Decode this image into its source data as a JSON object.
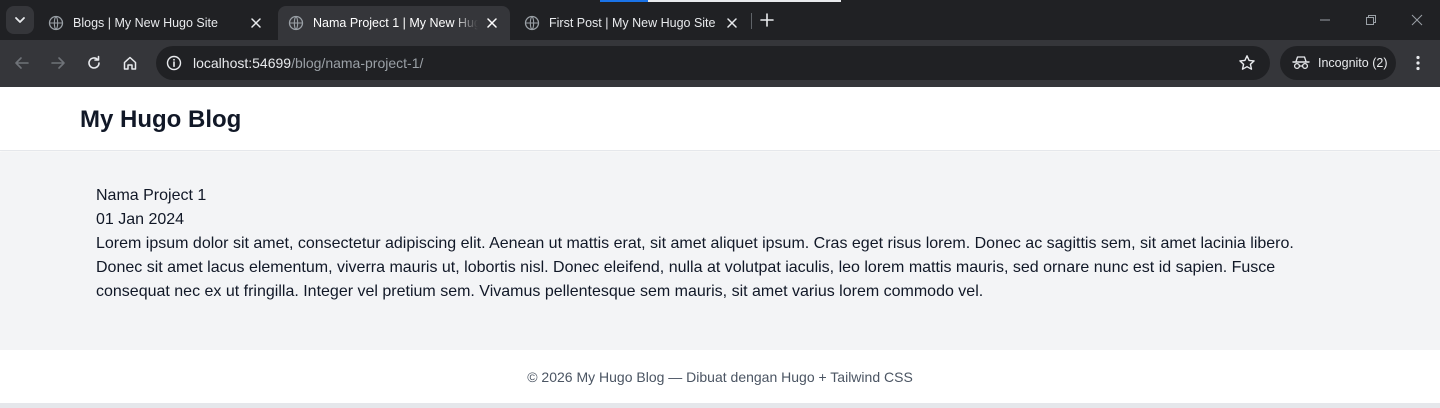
{
  "browser": {
    "tabs": [
      {
        "title": "Blogs | My New Hugo Site",
        "active": false
      },
      {
        "title": "Nama Project 1 | My New Hugo Site",
        "active": true
      },
      {
        "title": "First Post | My New Hugo Site",
        "active": false
      }
    ],
    "url_host": "localhost:54699",
    "url_path": "/blog/nama-project-1/",
    "incognito_label": "Incognito (2)"
  },
  "site": {
    "logo": "My Hugo Blog",
    "footer": "© 2026 My Hugo Blog — Dibuat dengan Hugo + Tailwind CSS"
  },
  "post": {
    "title": "Nama Project 1",
    "date": "01 Jan 2024",
    "body": "Lorem ipsum dolor sit amet, consectetur adipiscing elit. Aenean ut mattis erat, sit amet aliquet ipsum. Cras eget risus lorem. Donec ac sagittis sem, sit amet lacinia libero. Donec sit amet lacus elementum, viverra mauris ut, lobortis nisl. Donec eleifend, nulla at volutpat iaculis, leo lorem mattis mauris, sed ornare nunc est id sapien. Fusce consequat nec ex ut fringilla. Integer vel pretium sem. Vivamus pellentesque sem mauris, sit amet varius lorem commodo vel."
  },
  "icons": {
    "tab_search": "chevron-down-icon",
    "favicon": "globe-icon",
    "tab_close": "close-icon",
    "new_tab": "plus-icon",
    "back": "arrow-left-icon",
    "forward": "arrow-right-icon",
    "reload": "reload-icon",
    "home": "home-icon",
    "site_info": "info-icon",
    "bookmark": "star-icon",
    "incognito": "incognito-icon",
    "menu": "kebab-menu-icon"
  },
  "colors": {
    "chrome_frame": "#202124",
    "chrome_toolbar": "#35363a",
    "page_background": "#f3f4f6",
    "header_background": "#ffffff",
    "text_primary": "#111827",
    "text_muted": "#4b5563",
    "loading_accent": "#1a73e8"
  }
}
